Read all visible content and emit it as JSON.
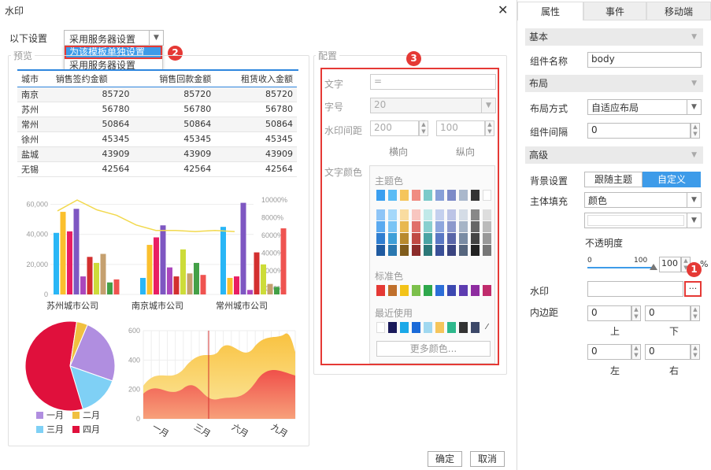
{
  "dialog": {
    "title": "水印",
    "close_glyph": "✕",
    "settings_label": "以下设置",
    "settings_value": "采用服务器设置",
    "dropdown_options": [
      "为该模板单独设置",
      "采用服务器设置"
    ],
    "preview_title": "预览",
    "config_title": "配置",
    "ok_label": "确定",
    "cancel_label": "取消"
  },
  "badges": {
    "b1": "1",
    "b2": "2",
    "b3": "3"
  },
  "preview_table": {
    "headers": [
      "城市",
      "销售签约金额",
      "销售回款金额",
      "租赁收入金额"
    ],
    "rows": [
      [
        "南京",
        "85720",
        "85720",
        "85720"
      ],
      [
        "苏州",
        "56780",
        "56780",
        "56780"
      ],
      [
        "常州",
        "50864",
        "50864",
        "50864"
      ],
      [
        "徐州",
        "45345",
        "45345",
        "45345"
      ],
      [
        "盐城",
        "43909",
        "43909",
        "43909"
      ],
      [
        "无锡",
        "42564",
        "42564",
        "42564"
      ]
    ]
  },
  "chart_data": [
    {
      "type": "bar",
      "categories": [
        "苏州城市公司",
        "南京城市公司",
        "常州城市公司"
      ],
      "yticks_left": [
        "60,000",
        "40,000",
        "20,000",
        "0"
      ],
      "yticks_right": [
        "10000%",
        "8000%",
        "6000%",
        "4000%",
        "2000%",
        "1000%"
      ],
      "series": [
        {
          "values": [
            41000,
            11000,
            45000
          ]
        },
        {
          "values": [
            55000,
            33000,
            11000
          ]
        },
        {
          "values": [
            42000,
            38000,
            12000
          ]
        },
        {
          "values": [
            57000,
            46000,
            61000
          ]
        },
        {
          "values": [
            12000,
            18000,
            3000
          ]
        },
        {
          "values": [
            25000,
            12000,
            28000
          ]
        },
        {
          "values": [
            21000,
            30000,
            20000
          ]
        },
        {
          "values": [
            27000,
            14000,
            7000
          ]
        },
        {
          "values": [
            8000,
            21000,
            5000
          ]
        },
        {
          "values": [
            10000,
            13000,
            44000
          ]
        }
      ],
      "line_values_pct": [
        8700,
        9700,
        8800,
        8300,
        7400,
        6900,
        6900,
        6800,
        6900,
        6800
      ],
      "colors": [
        "#29b6f6",
        "#fbc02d",
        "#e91e63",
        "#7e57c2",
        "#ab47bc",
        "#d32f2f",
        "#cddc39",
        "#c5a06f",
        "#43a047",
        "#ef5350"
      ]
    },
    {
      "type": "pie",
      "series": [
        {
          "name": "一月",
          "value": 24,
          "color": "#b08ee0"
        },
        {
          "name": "二月",
          "value": 4,
          "color": "#f0c040"
        },
        {
          "name": "三月",
          "value": 15,
          "color": "#7fd0f5"
        },
        {
          "name": "四月",
          "value": 57,
          "color": "#e0103c"
        }
      ]
    },
    {
      "type": "area",
      "categories": [
        "一月",
        "三月",
        "六月",
        "九月"
      ],
      "yticks": [
        "600",
        "400",
        "200",
        "0"
      ],
      "ylim": [
        0,
        600
      ]
    }
  ],
  "config": {
    "text_label": "文字",
    "text_value": "=",
    "font_size_label": "字号",
    "font_size_value": "20",
    "spacing_label": "水印间距",
    "spacing_h": "200",
    "spacing_v": "100",
    "horizontal_label": "横向",
    "vertical_label": "纵向",
    "color_label": "文字颜色",
    "theme_colors_label": "主题色",
    "standard_colors_label": "标准色",
    "recent_label": "最近使用",
    "more_colors_label": "更多颜色..."
  },
  "palette": {
    "theme_top": [
      "#3a9ff0",
      "#5bbcf5",
      "#f5c55b",
      "#f08c82",
      "#7bcaca",
      "#88a0d8",
      "#7d8bc8",
      "#aab8cc",
      "#333333",
      "#ffffff"
    ],
    "shades": [
      [
        "#8ec5f7",
        "#a5d8fa",
        "#f9dca0",
        "#f8c6c0",
        "#c0e9e9",
        "#c4d0ee",
        "#bcc4e6",
        "#d4dce6",
        "#888888",
        "#dddddd"
      ],
      [
        "#5aaaf0",
        "#7ac4f5",
        "#e8b850",
        "#e0706a",
        "#88cfcf",
        "#8ea6dd",
        "#8c98cc",
        "#a6b4c6",
        "#666666",
        "#bbbbbb"
      ],
      [
        "#2f7ed0",
        "#3e9fd8",
        "#b88a2e",
        "#c04a44",
        "#4aa4a4",
        "#5a78c4",
        "#5a66a8",
        "#7a8ca4",
        "#444444",
        "#999999"
      ],
      [
        "#1f5aa0",
        "#2a78b0",
        "#805c1c",
        "#8c2c2a",
        "#2c7878",
        "#3a5098",
        "#3a4480",
        "#56667e",
        "#222222",
        "#777777"
      ]
    ],
    "standard": [
      "#e53935",
      "#c0702c",
      "#f3c318",
      "#7cc04c",
      "#2ea84c",
      "#2c6ed8",
      "#3c48b0",
      "#5d3cb0",
      "#8e2ca0",
      "#c02c6c"
    ],
    "recent": [
      "#ffffff",
      "#1a1a5a",
      "#1aa8e8",
      "#1a6ad8",
      "#a0d8f0",
      "#f5c55b",
      "#2eb88c",
      "#333333",
      "#3c4868"
    ]
  },
  "right_panel": {
    "tabs": [
      "属性",
      "事件",
      "移动端"
    ],
    "section_basic": "基本",
    "component_name_label": "组件名称",
    "component_name_value": "body",
    "section_layout": "布局",
    "layout_mode_label": "布局方式",
    "layout_mode_value": "自适应布局",
    "spacing_label": "组件间隔",
    "spacing_value": "0",
    "section_advanced": "高级",
    "bg_label": "背景设置",
    "bg_follow_theme": "跟随主题",
    "bg_custom": "自定义",
    "fill_label": "主体填充",
    "fill_value": "颜色",
    "opacity_label": "不透明度",
    "opacity_min": "0",
    "opacity_max": "100",
    "opacity_value": "100",
    "opacity_unit": "%",
    "opacity_level_pct": 100,
    "watermark_label": "水印",
    "watermark_value": "",
    "watermark_btn": "···",
    "padding_label": "内边距",
    "padding_top": "0",
    "padding_bottom": "0",
    "padding_left": "0",
    "padding_right": "0",
    "top_label": "上",
    "bottom_label": "下",
    "left_label": "左",
    "right_label": "右",
    "accent_color": "#3d9be9"
  }
}
